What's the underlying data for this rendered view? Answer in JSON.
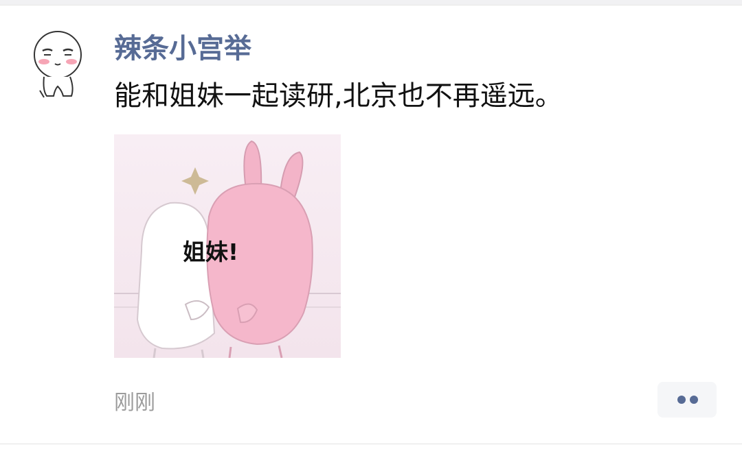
{
  "moment": {
    "username": "辣条小宫举",
    "text": "能和姐妹一起读研,北京也不再遥远。",
    "sticker": {
      "caption": "姐妹!",
      "icon": "bunny-hug-sticker"
    },
    "timestamp": "刚刚",
    "more_icon": "more-dots-icon"
  },
  "colors": {
    "link_blue": "#576b95",
    "text": "#111111",
    "timestamp_gray": "#9b9b9b",
    "button_bg": "#f5f6f8"
  }
}
